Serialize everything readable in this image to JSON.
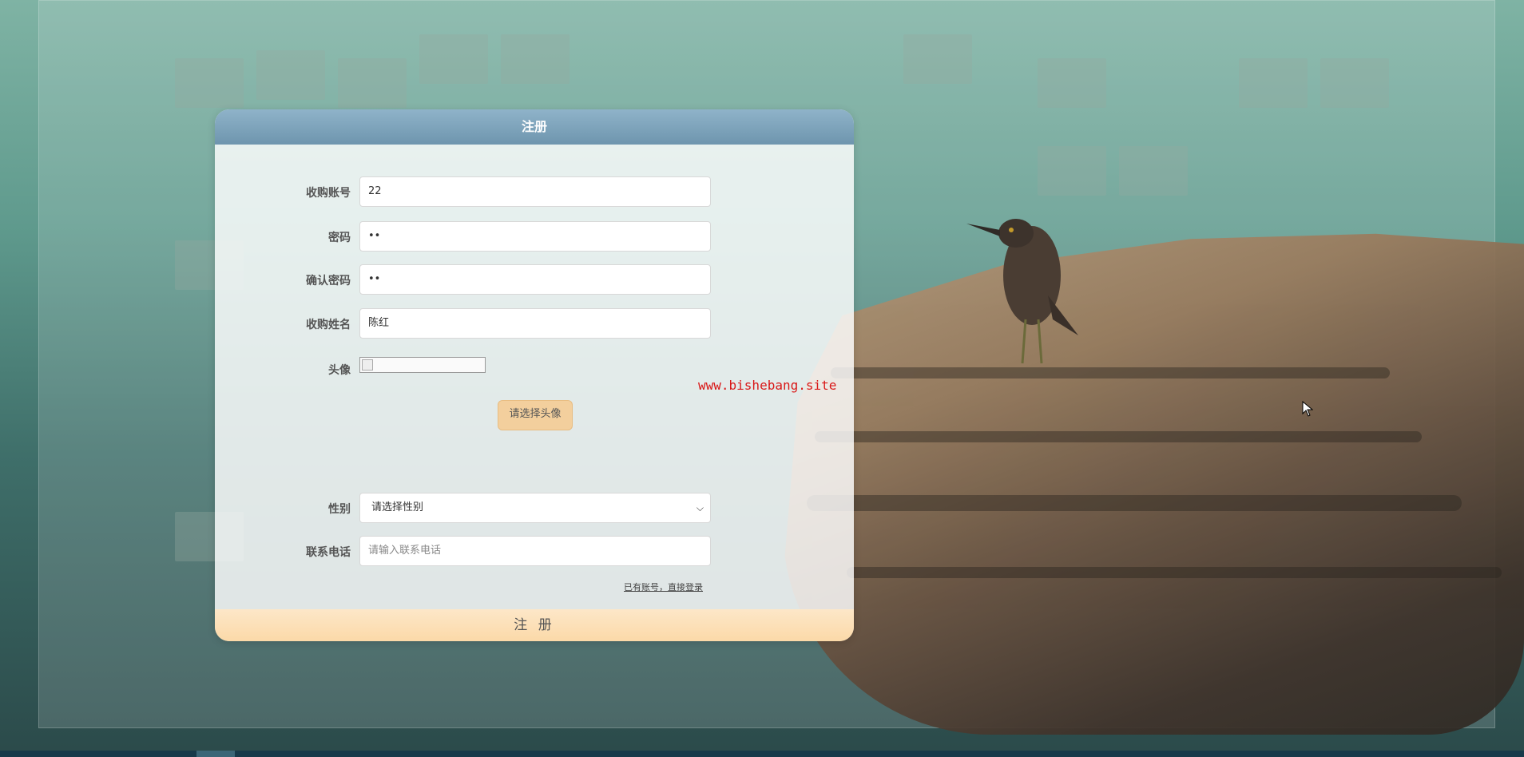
{
  "form": {
    "title": "注册",
    "account_label": "收购账号",
    "account_value": "22",
    "password_label": "密码",
    "password_value": "••",
    "confirm_label": "确认密码",
    "confirm_value": "••",
    "name_label": "收购姓名",
    "name_value": "陈红",
    "avatar_label": "头像",
    "choose_avatar_button": "请选择头像",
    "gender_label": "性别",
    "gender_value": "请选择性别",
    "phone_label": "联系电话",
    "phone_placeholder": "请输入联系电话",
    "login_link": "已有账号，直接登录",
    "submit_button": "注 册"
  },
  "watermark": "www.bishebang.site",
  "colors": {
    "header": "#7fa3bb",
    "submit": "#fbd9a8",
    "avatar_button": "#f3cf9d",
    "watermark": "#d91818"
  },
  "icons": {
    "select_arrow": "chevron-down-icon",
    "cursor": "mouse-pointer-icon"
  }
}
